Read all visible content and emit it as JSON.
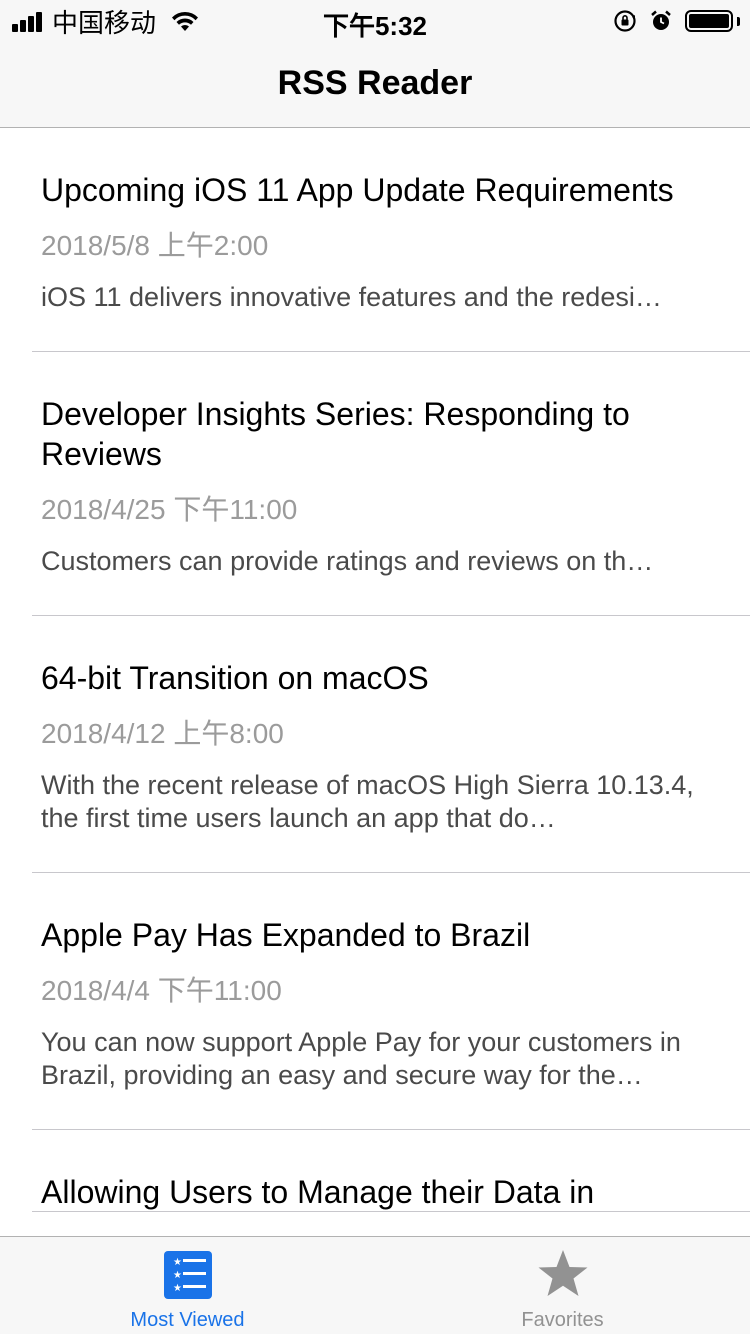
{
  "status_bar": {
    "carrier": "中国移动",
    "time": "下午5:32"
  },
  "nav": {
    "title": "RSS Reader"
  },
  "articles": [
    {
      "title": "Upcoming iOS 11 App Update Requirements",
      "date": "2018/5/8 上午2:00",
      "description": "iOS 11 delivers innovative features and the redesi…"
    },
    {
      "title": "Developer Insights Series: Responding to Reviews",
      "date": "2018/4/25 下午11:00",
      "description": "Customers can provide ratings and reviews on th…"
    },
    {
      "title": "64-bit Transition on macOS",
      "date": "2018/4/12 上午8:00",
      "description": "With the recent release of macOS High Sierra 10.13.4, the first time users launch an app that do…"
    },
    {
      "title": "Apple Pay Has Expanded to Brazil",
      "date": "2018/4/4 下午11:00",
      "description": "You can now support Apple Pay for your customers in Brazil, providing an easy and secure way for the…"
    },
    {
      "title": "Allowing Users to Manage their Data in",
      "date": "",
      "description": ""
    }
  ],
  "tabs": [
    {
      "label": "Most Viewed",
      "icon": "list-icon",
      "active": true
    },
    {
      "label": "Favorites",
      "icon": "star-icon",
      "active": false
    }
  ],
  "colors": {
    "accent": "#1a73e8",
    "inactive": "#929292",
    "date_text": "#9b9b9b",
    "desc_text": "#4a4a4a"
  }
}
